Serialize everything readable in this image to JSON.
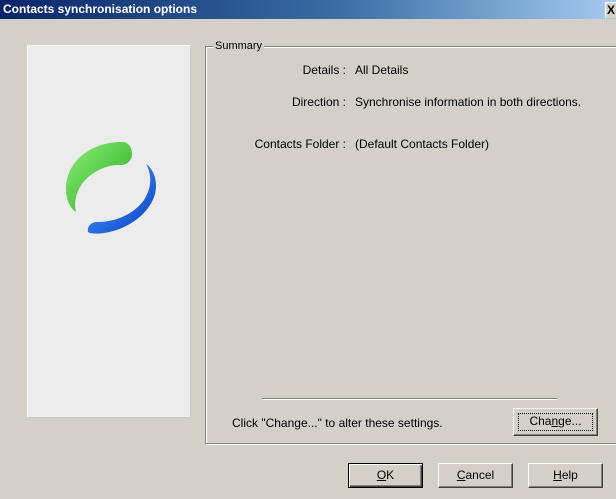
{
  "window": {
    "title": "Contacts synchronisation options",
    "close_glyph": "X"
  },
  "logo": {
    "icon": "sync-arrows-icon",
    "colors": {
      "green": "#3dc830",
      "blue": "#1a5ee0"
    }
  },
  "summary": {
    "group_label": "Summary",
    "rows": [
      {
        "label": "Details :",
        "value": "All Details"
      },
      {
        "label": "Direction :",
        "value": "Synchronise information in both directions."
      },
      {
        "label": "Contacts Folder :",
        "value": "(Default Contacts Folder)"
      }
    ],
    "hint": "Click \"Change...\" to alter these settings.",
    "change_button": {
      "prefix": "Cha",
      "mnemonic": "n",
      "suffix": "ge..."
    }
  },
  "buttons": {
    "ok": {
      "mnemonic": "O",
      "suffix": "K"
    },
    "cancel": {
      "mnemonic": "C",
      "suffix": "ancel"
    },
    "help": {
      "mnemonic": "H",
      "suffix": "elp"
    }
  }
}
